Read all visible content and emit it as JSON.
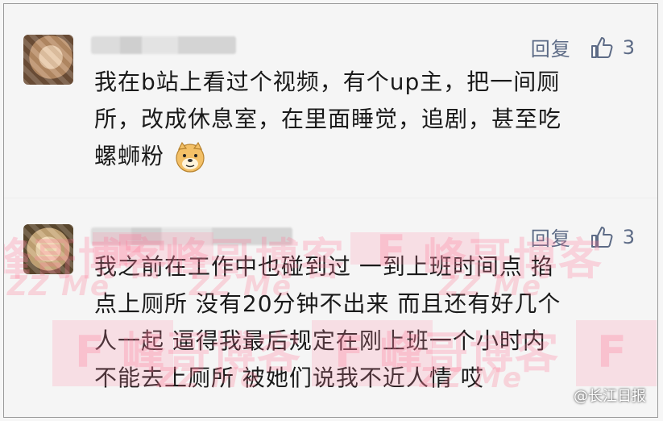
{
  "comments": [
    {
      "reply_label": "回复",
      "like_count": "3",
      "lines": [
        "我在b站上看过个视频，有个up主，把一间厕",
        "所，改成休息室，在里面睡觉，追剧，甚至吃",
        "螺蛳粉"
      ],
      "emoji": "doge-emoji"
    },
    {
      "reply_label": "回复",
      "like_count": "3",
      "lines": [
        "我之前在工作中也碰到过 一到上班时间点 掐",
        "点上厕所 没有20分钟不出来 而且还有好几个",
        "人一起 逼得我最后规定在刚上班一个小时内",
        "不能去上厕所 被她们说我不近人情 哎"
      ]
    }
  ],
  "watermark": {
    "text": "峰哥博客",
    "letter": "F",
    "small_text": "ZZ Me"
  },
  "source_label": "@长江日报"
}
